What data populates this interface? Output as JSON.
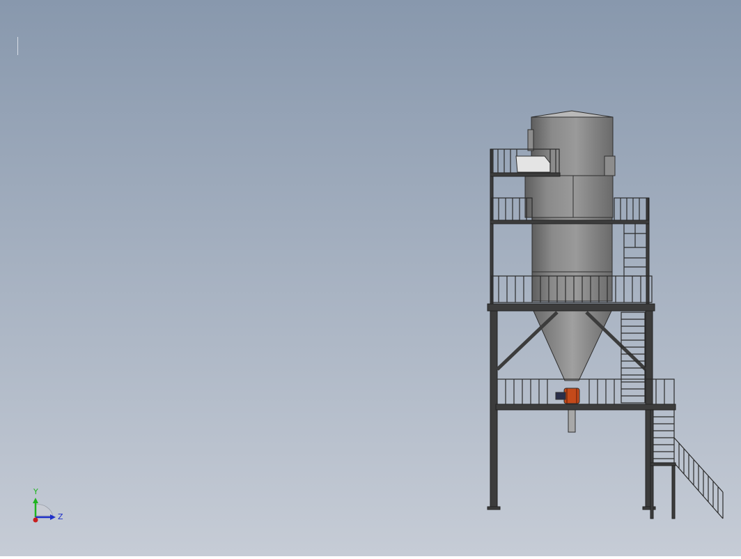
{
  "viewport": {
    "background_top": "#8898ad",
    "background_bottom": "#c6ccd6",
    "model": "silo-with-platforms-and-stairs"
  },
  "triad": {
    "y_label": "Y",
    "z_label": "Z",
    "y_color": "#1fb41f",
    "z_color": "#1f2fc8",
    "x_color": "#c81e1e"
  },
  "colors": {
    "steel": "#3c3c3c",
    "silo_light": "#9a9a9a",
    "silo_dark": "#5e5e5e",
    "valve": "#c44a1a"
  }
}
